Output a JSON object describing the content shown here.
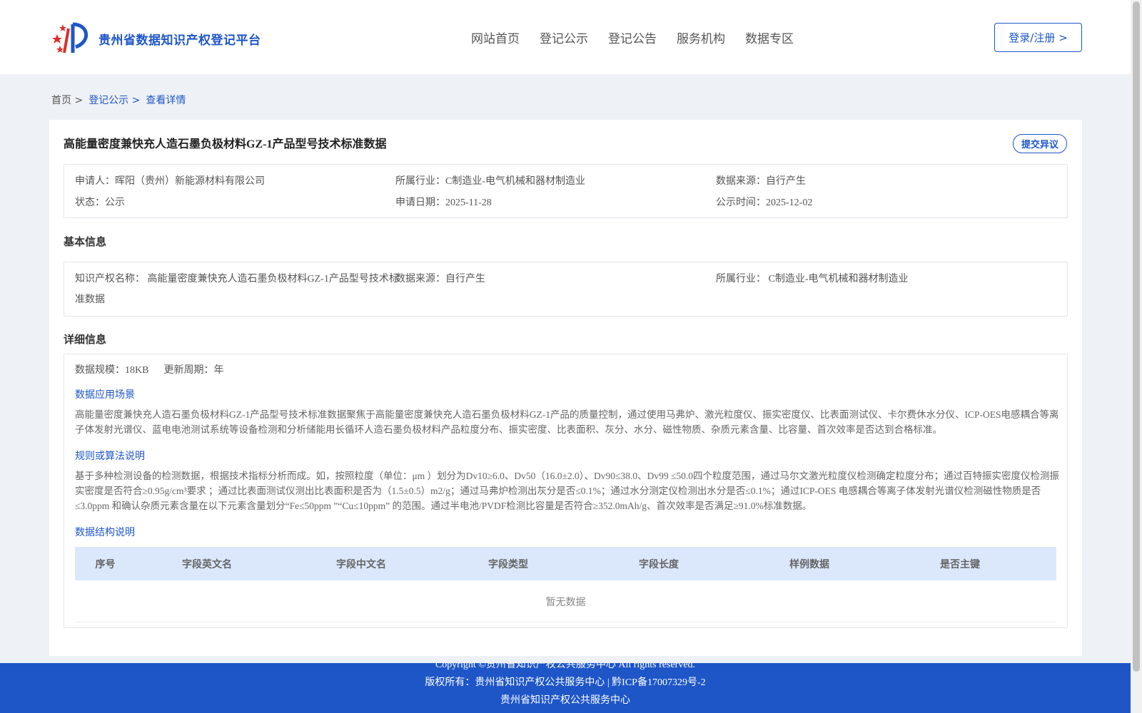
{
  "header": {
    "site_title": "贵州省数据知识产权登记平台",
    "nav": [
      "网站首页",
      "登记公示",
      "登记公告",
      "服务机构",
      "数据专区"
    ],
    "login_label": "登录/注册 >"
  },
  "breadcrumb": {
    "home": "首页 >",
    "list": "登记公示 >",
    "current": "查看详情"
  },
  "detail": {
    "title": "高能量密度兼快充人造石墨负极材料GZ-1产品型号技术标准数据",
    "objection_label": "提交异议",
    "applicant_label": "申请人：",
    "applicant": "晖阳（贵州）新能源材料有限公司",
    "industry_label": "所属行业：",
    "industry": "C制造业-电气机械和器材制造业",
    "source_label": "数据来源：",
    "source": "自行产生",
    "status_label": "状态：",
    "status": "公示",
    "apply_date_label": "申请日期：",
    "apply_date": "2025-11-28",
    "publish_date_label": "公示时间：",
    "publish_date": "2025-12-02"
  },
  "basic": {
    "heading": "基本信息",
    "name_label": "知识产权名称：",
    "name_line1": "高能量密度兼快充人造石墨负极材料GZ-1产品型号技术标",
    "name_line2": "准数据",
    "source_label": "数据来源：",
    "source": "自行产生",
    "industry_label": "所属行业：",
    "industry": "C制造业-电气机械和器材制造业"
  },
  "details": {
    "heading": "详细信息",
    "scale_label": "数据规模：",
    "scale": "18KB",
    "cycle_label": "更新周期：",
    "cycle": "年",
    "scenario_title": "数据应用场景",
    "scenario_text": "高能量密度兼快充人造石墨负极材料GZ-1产品型号技术标准数据聚焦于高能量密度兼快充人造石墨负极材料GZ-1产品的质量控制，通过使用马弗炉、激光粒度仪、振实密度仪、比表面测试仪、卡尔费休水分仪、ICP-OES电感耦合等离子体发射光谱仪、蓝电电池测试系统等设备检测和分析储能用长循环人造石墨负极材料产品粒度分布、振实密度、比表面积、灰分、水分、磁性物质、杂质元素含量、比容量、首次效率是否达到合格标准。",
    "rules_title": "规则或算法说明",
    "rules_text": "基于多种检测设备的检测数据，根据技术指标分析而成。如，按照粒度（单位：μm ）划分为Dv10≥6.0、Dv50（16.0±2.0）、Dv90≤38.0、Dv99 ≤50.0四个粒度范围，通过马尔文激光粒度仪检测确定粒度分布；通过百特振实密度仪检测振实密度是否符合≥0.95g/cm³要求 ；通过比表面测试仪测出比表面积是否为（1.5±0.5）m2/g；通过马弗炉检测出灰分是否≤0.1%；通过水分测定仪检测出水分是否≤0.1%；通过ICP-OES 电感耦合等离子体发射光谱仪检测磁性物质是否≤3.0ppm 和确认杂质元素含量在以下元素含量划分“Fe≤50ppm ”“Cu≤10ppm” 的范围。通过半电池/PVDF检测比容量是否符合≥352.0mAh/g、首次效率是否满足≥91.0%标准数据。",
    "structure_title": "数据结构说明",
    "table_headers": [
      "序号",
      "字段英文名",
      "字段中文名",
      "字段类型",
      "字段长度",
      "样例数据",
      "是否主键"
    ],
    "empty_text": "暂无数据"
  },
  "footer": {
    "line1": "Copyright ©贵州省知识产权公共服务中心 All rights reserved.",
    "line2": "版权所有：贵州省知识产权公共服务中心 | 黔ICP备17007329号-2",
    "line3": "贵州省知识产权公共服务中心"
  },
  "colors": {
    "brand": "#1e56c8",
    "page_bg": "#eef1f5",
    "table_head_bg": "#dbe8fb"
  }
}
